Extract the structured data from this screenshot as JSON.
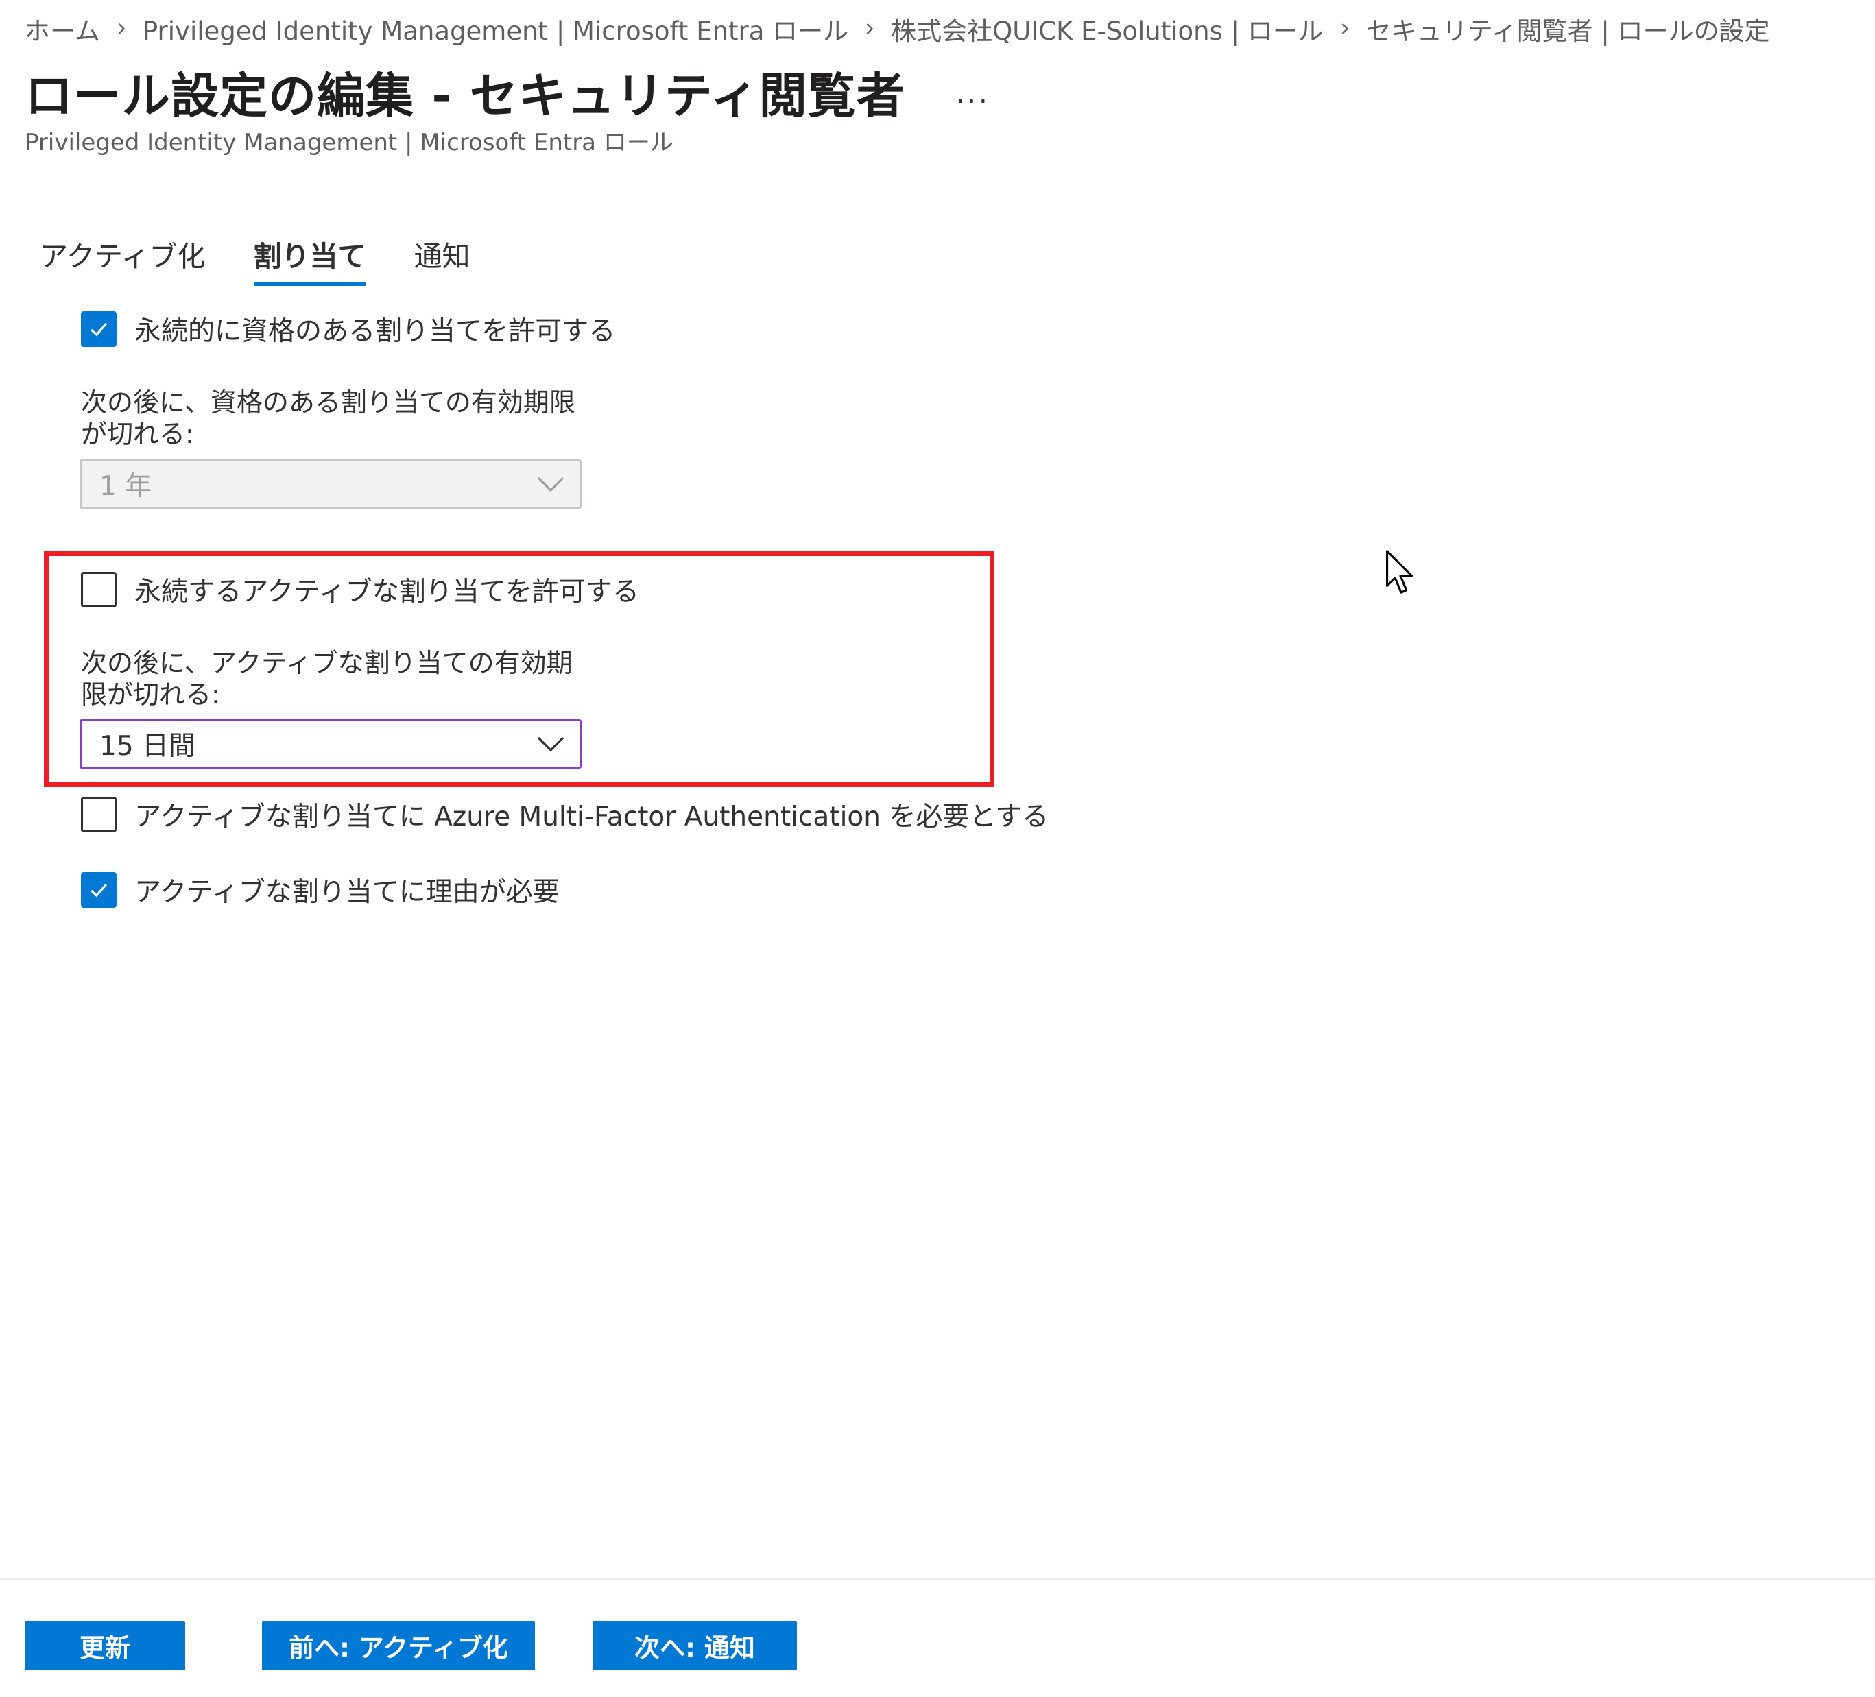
{
  "breadcrumb": {
    "items": [
      "ホーム",
      "Privileged Identity Management | Microsoft Entra ロール",
      "株式会社QUICK E-Solutions | ロール",
      "セキュリティ閲覧者 | ロールの設定"
    ]
  },
  "header": {
    "title": "ロール設定の編集 - セキュリティ閲覧者",
    "more": "...",
    "subtitle": "Privileged Identity Management | Microsoft Entra ロール"
  },
  "tabs": [
    {
      "label": "アクティブ化",
      "active": false
    },
    {
      "label": "割り当て",
      "active": true
    },
    {
      "label": "通知",
      "active": false
    }
  ],
  "settings": {
    "permanent_eligible": {
      "label": "永続的に資格のある割り当てを許可する",
      "checked": true
    },
    "eligible_expiry": {
      "label": "次の後に、資格のある割り当ての有効期限が切れる:",
      "value": "1 年",
      "disabled": true
    },
    "permanent_active": {
      "label": "永続するアクティブな割り当てを許可する",
      "checked": false
    },
    "active_expiry": {
      "label": "次の後に、アクティブな割り当ての有効期限が切れる:",
      "value": "15 日間",
      "disabled": false
    },
    "require_mfa": {
      "label": "アクティブな割り当てに Azure Multi-Factor Authentication を必要とする",
      "checked": false
    },
    "require_justification": {
      "label": "アクティブな割り当てに理由が必要",
      "checked": true
    }
  },
  "footer": {
    "update_label": "更新",
    "prev_label": "前へ: アクティブ化",
    "next_label": "次へ: 通知"
  },
  "colors": {
    "accent": "#0078d4",
    "highlight": "#ee1c24",
    "focus": "#8a3ec8"
  },
  "icons": {
    "breadcrumb_separator": "chevron-right-icon",
    "dropdown": "chevron-down-icon",
    "checkbox": "checkmark-icon",
    "cursor": "mouse-pointer-icon"
  }
}
